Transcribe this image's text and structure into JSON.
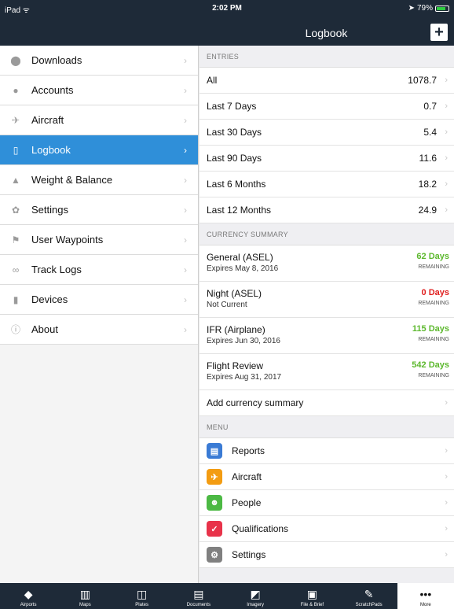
{
  "status": {
    "carrier": "iPad ᯤ",
    "time": "2:02 PM",
    "battery": "79%"
  },
  "nav": {
    "title": "Logbook",
    "add_icon": "plus-icon"
  },
  "sidebar": {
    "items": [
      {
        "label": "Downloads",
        "icon": "download-icon"
      },
      {
        "label": "Accounts",
        "icon": "user-icon"
      },
      {
        "label": "Aircraft",
        "icon": "airplane-icon"
      },
      {
        "label": "Logbook",
        "icon": "book-icon"
      },
      {
        "label": "Weight & Balance",
        "icon": "scale-icon"
      },
      {
        "label": "Settings",
        "icon": "gear-icon"
      },
      {
        "label": "User Waypoints",
        "icon": "flag-icon"
      },
      {
        "label": "Track Logs",
        "icon": "track-icon"
      },
      {
        "label": "Devices",
        "icon": "plug-icon"
      },
      {
        "label": "About",
        "icon": "info-icon"
      }
    ]
  },
  "entries": {
    "header": "ENTRIES",
    "rows": [
      {
        "label": "All",
        "value": "1078.7"
      },
      {
        "label": "Last 7 Days",
        "value": "0.7"
      },
      {
        "label": "Last 30 Days",
        "value": "5.4"
      },
      {
        "label": "Last 90 Days",
        "value": "11.6"
      },
      {
        "label": "Last 6 Months",
        "value": "18.2"
      },
      {
        "label": "Last 12 Months",
        "value": "24.9"
      }
    ]
  },
  "currency": {
    "header": "CURRENCY SUMMARY",
    "rows": [
      {
        "title": "General (ASEL)",
        "sub": "Expires May 8, 2016",
        "days": "62 Days",
        "remaining": "REMAINING",
        "color": "#5cb82d"
      },
      {
        "title": "Night (ASEL)",
        "sub": "Not Current",
        "days": "0 Days",
        "remaining": "REMAINING",
        "color": "#e02020"
      },
      {
        "title": "IFR (Airplane)",
        "sub": "Expires Jun 30, 2016",
        "days": "115 Days",
        "remaining": "REMAINING",
        "color": "#5cb82d"
      },
      {
        "title": "Flight Review",
        "sub": "Expires Aug 31, 2017",
        "days": "542 Days",
        "remaining": "REMAINING",
        "color": "#5cb82d"
      }
    ],
    "add_label": "Add currency summary"
  },
  "menu": {
    "header": "MENU",
    "items": [
      {
        "label": "Reports",
        "icon": "document-icon",
        "color": "#3a7bd5"
      },
      {
        "label": "Aircraft",
        "icon": "airplane-icon",
        "color": "#f39c12"
      },
      {
        "label": "People",
        "icon": "people-icon",
        "color": "#4cb944"
      },
      {
        "label": "Qualifications",
        "icon": "check-badge-icon",
        "color": "#e8334a"
      },
      {
        "label": "Settings",
        "icon": "gear-icon",
        "color": "#808080"
      }
    ]
  },
  "tabs": [
    {
      "label": "Airports",
      "icon": "compass-icon"
    },
    {
      "label": "Maps",
      "icon": "map-icon"
    },
    {
      "label": "Plates",
      "icon": "plate-icon"
    },
    {
      "label": "Documents",
      "icon": "documents-icon"
    },
    {
      "label": "Imagery",
      "icon": "imagery-icon"
    },
    {
      "label": "File & Brief",
      "icon": "clipboard-icon"
    },
    {
      "label": "ScratchPads",
      "icon": "pen-icon"
    },
    {
      "label": "More",
      "icon": "more-icon"
    }
  ]
}
